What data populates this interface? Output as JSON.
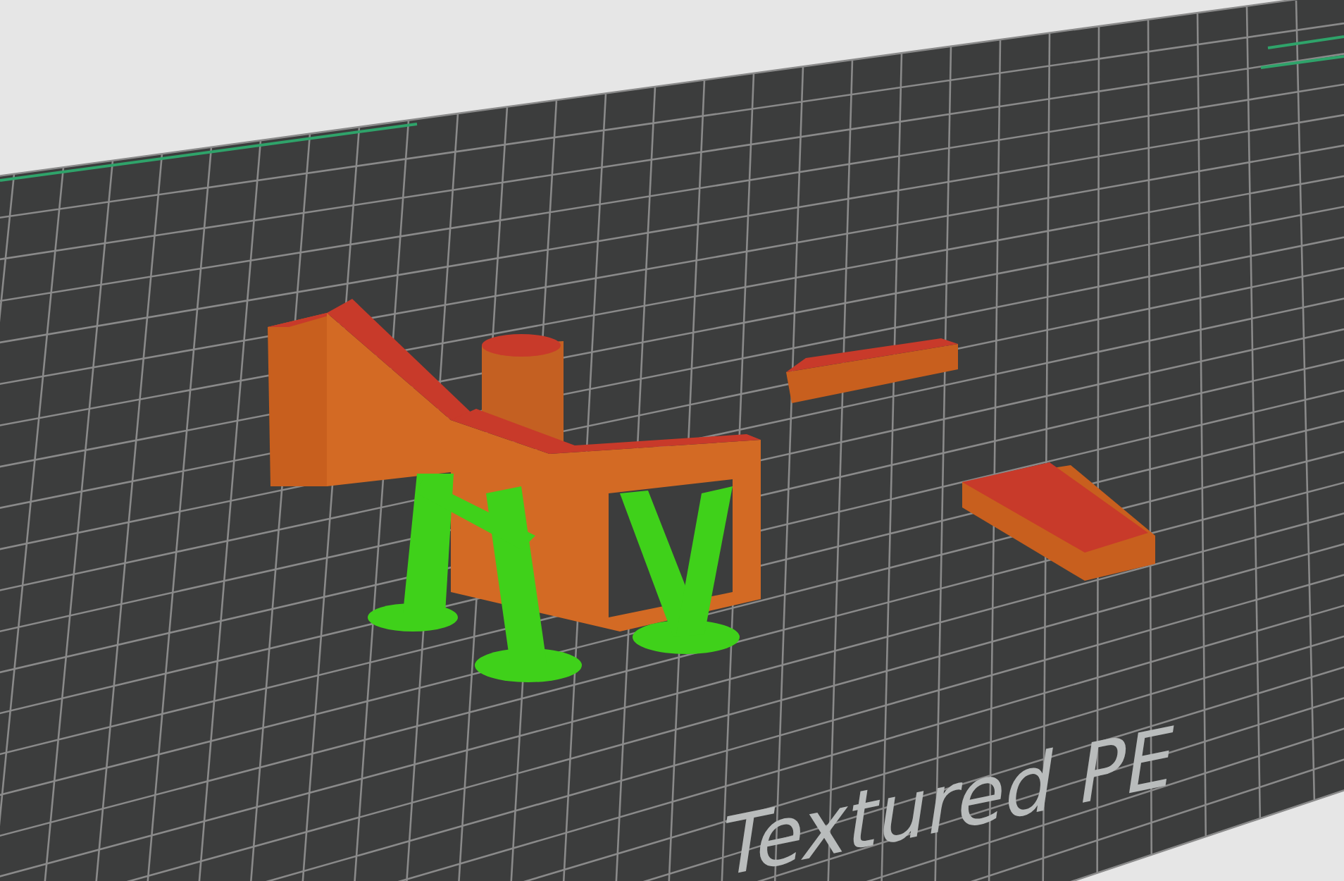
{
  "bed": {
    "label": "Textured PE"
  }
}
